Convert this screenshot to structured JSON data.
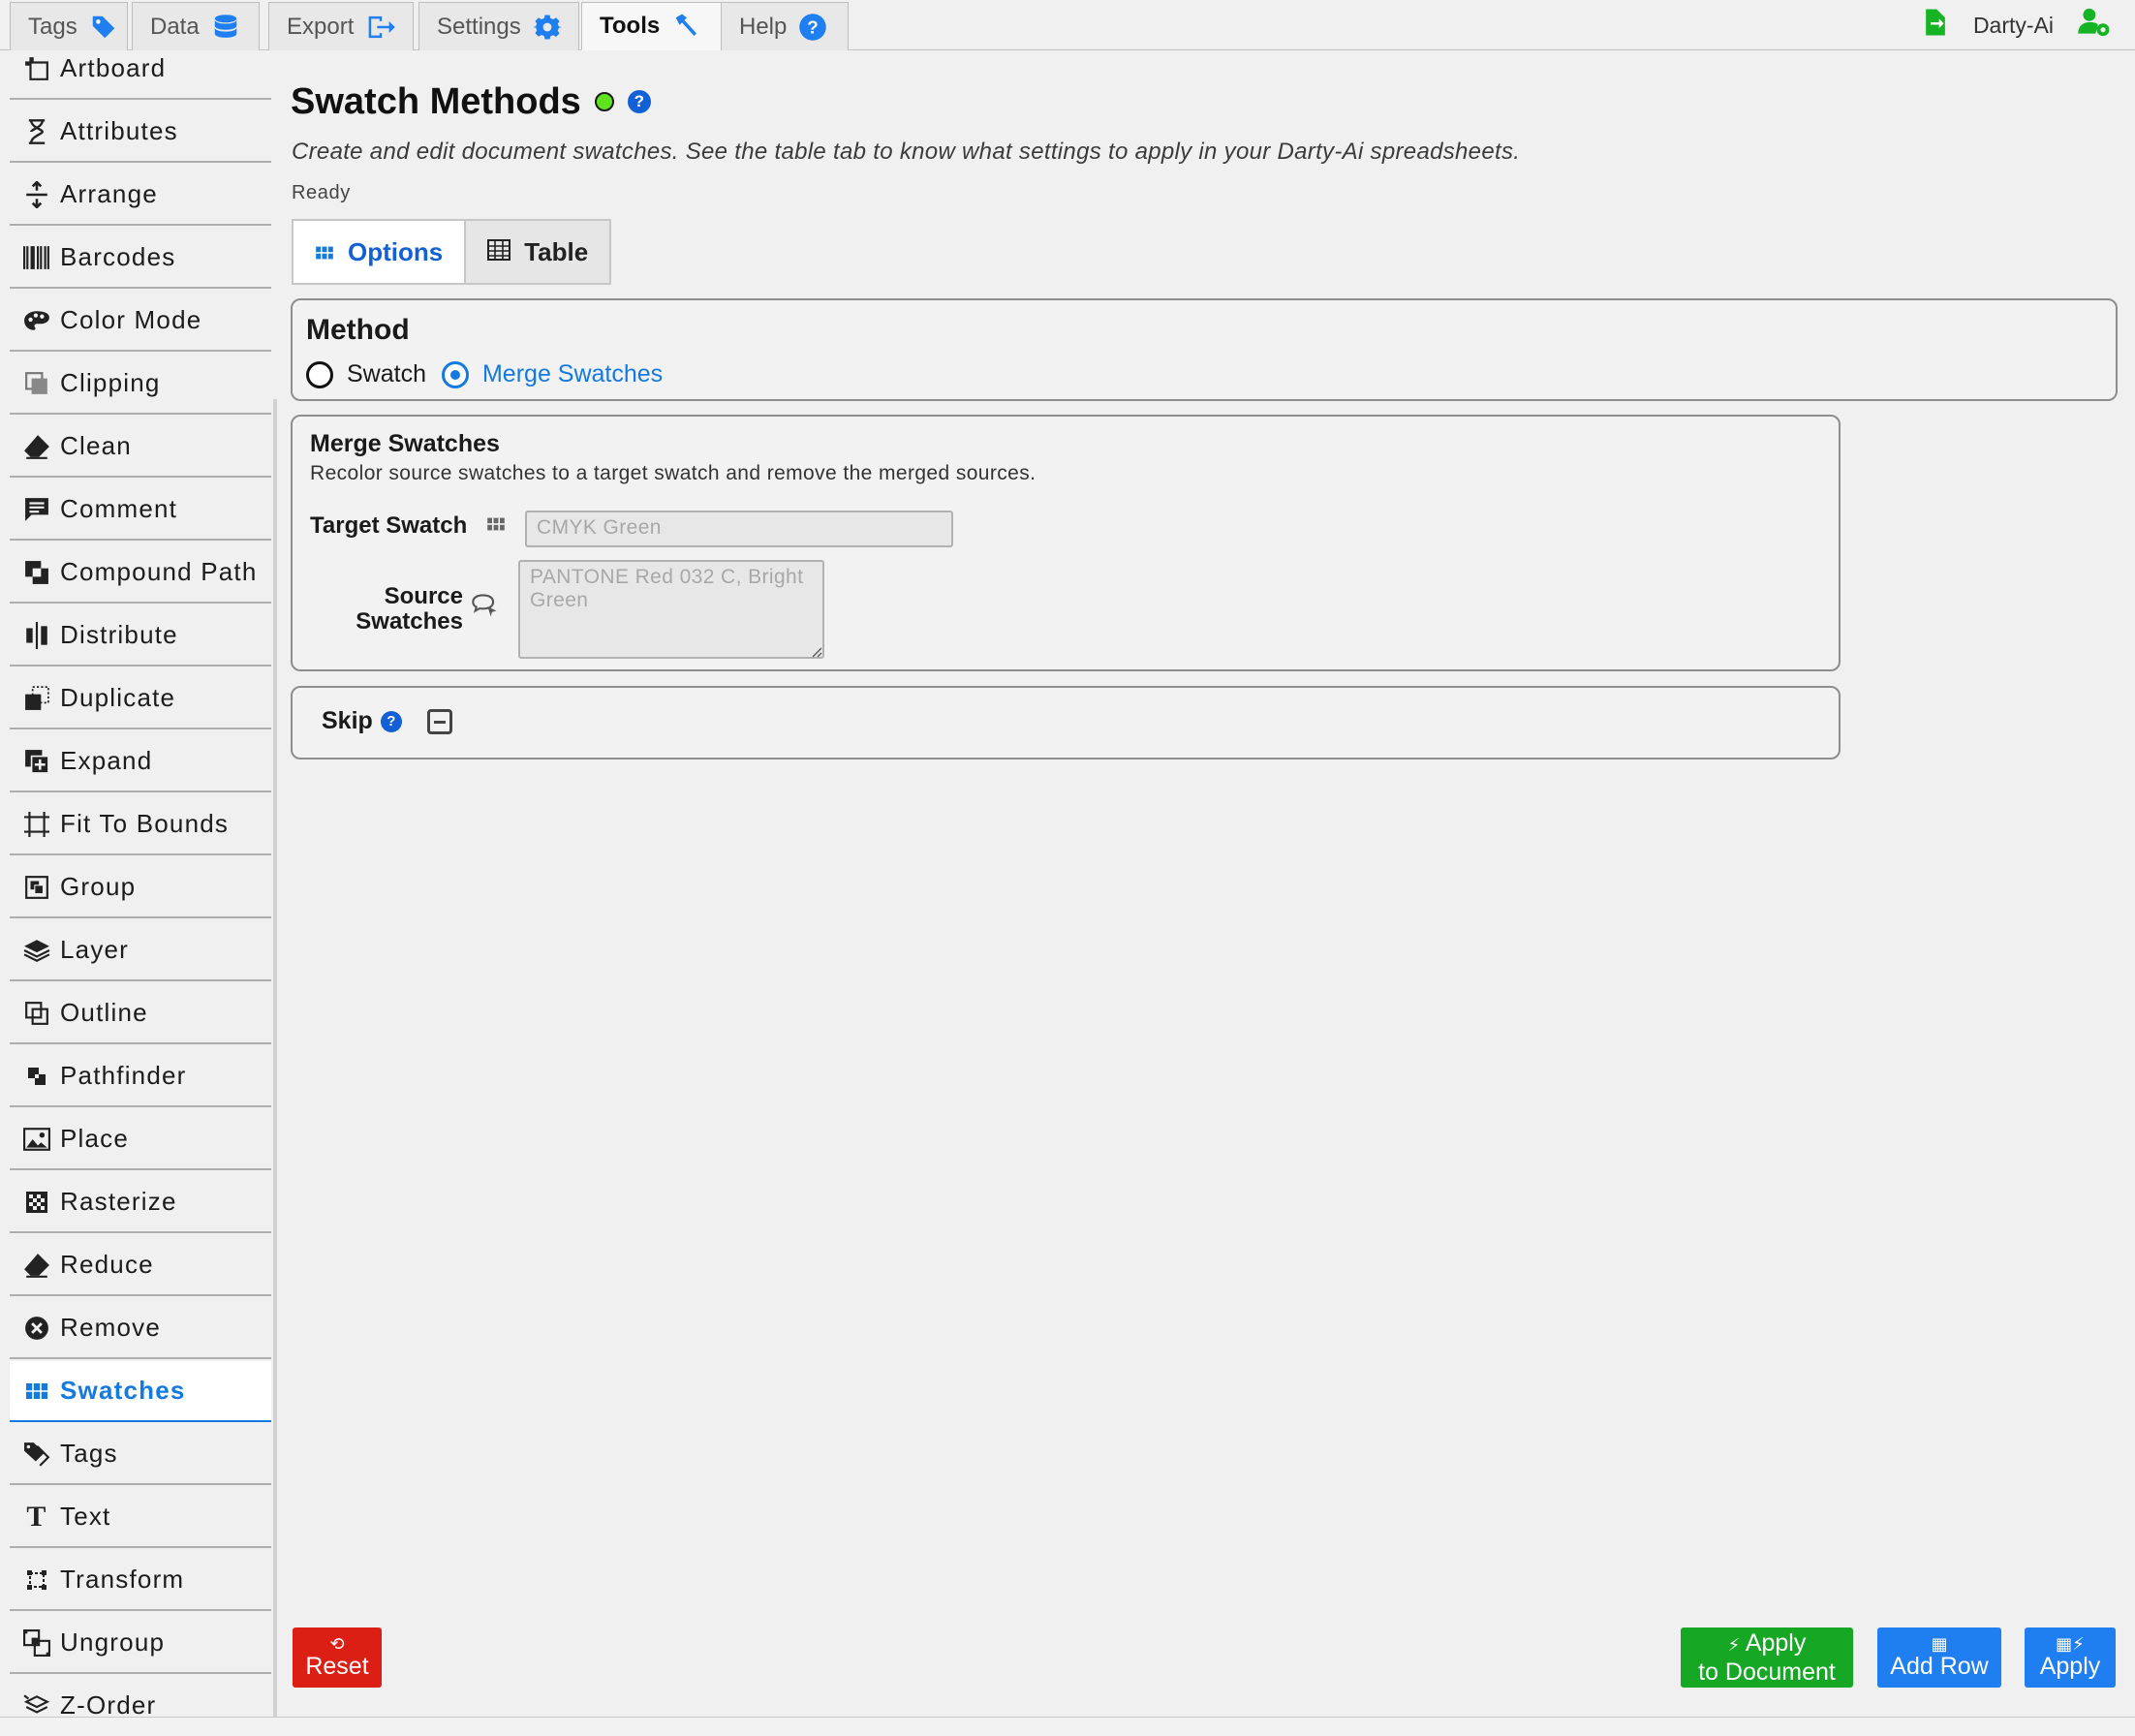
{
  "top_tabs": [
    {
      "label": "Tags",
      "icon": "tag-icon"
    },
    {
      "label": "Data",
      "icon": "database-icon"
    },
    {
      "label": "Export",
      "icon": "export-icon"
    },
    {
      "label": "Settings",
      "icon": "gear-icon"
    },
    {
      "label": "Tools",
      "icon": "hammer-icon"
    },
    {
      "label": "Help",
      "icon": "help-icon"
    }
  ],
  "active_top_tab": "Tools",
  "user": {
    "name": "Darty-Ai"
  },
  "sidebar": {
    "items": [
      {
        "label": "Artboard",
        "icon": "artboard-icon"
      },
      {
        "label": "Attributes",
        "icon": "attributes-icon"
      },
      {
        "label": "Arrange",
        "icon": "arrange-icon"
      },
      {
        "label": "Barcodes",
        "icon": "barcode-icon"
      },
      {
        "label": "Color Mode",
        "icon": "palette-icon"
      },
      {
        "label": "Clipping",
        "icon": "clipping-icon"
      },
      {
        "label": "Clean",
        "icon": "eraser-icon"
      },
      {
        "label": "Comment",
        "icon": "comment-icon"
      },
      {
        "label": "Compound Path",
        "icon": "compound-path-icon"
      },
      {
        "label": "Distribute",
        "icon": "distribute-icon"
      },
      {
        "label": "Duplicate",
        "icon": "duplicate-icon"
      },
      {
        "label": "Expand",
        "icon": "expand-icon"
      },
      {
        "label": "Fit To Bounds",
        "icon": "fit-bounds-icon"
      },
      {
        "label": "Group",
        "icon": "group-icon"
      },
      {
        "label": "Layer",
        "icon": "layer-icon"
      },
      {
        "label": "Outline",
        "icon": "outline-icon"
      },
      {
        "label": "Pathfinder",
        "icon": "pathfinder-icon"
      },
      {
        "label": "Place",
        "icon": "image-icon"
      },
      {
        "label": "Rasterize",
        "icon": "checker-icon"
      },
      {
        "label": "Reduce",
        "icon": "eraser-icon"
      },
      {
        "label": "Remove",
        "icon": "remove-icon"
      },
      {
        "label": "Swatches",
        "icon": "swatches-icon"
      },
      {
        "label": "Tags",
        "icon": "tags-icon"
      },
      {
        "label": "Text",
        "icon": "text-icon"
      },
      {
        "label": "Transform",
        "icon": "transform-icon"
      },
      {
        "label": "Ungroup",
        "icon": "ungroup-icon"
      },
      {
        "label": "Z-Order",
        "icon": "z-order-icon"
      }
    ],
    "active": "Swatches"
  },
  "main": {
    "title": "Swatch Methods",
    "description": "Create and edit document swatches. See the table tab to know what settings to apply in your Darty-Ai spreadsheets.",
    "status": "Ready",
    "status_color": "#5ee31f",
    "tabs": [
      {
        "label": "Options",
        "active": true
      },
      {
        "label": "Table",
        "active": false
      }
    ],
    "method": {
      "title": "Method",
      "options": [
        "Swatch",
        "Merge Swatches"
      ],
      "selected": "Merge Swatches"
    },
    "merge": {
      "title": "Merge Swatches",
      "subtitle": "Recolor source swatches to a target swatch and remove the merged sources.",
      "target_label": "Target Swatch",
      "target_placeholder": "CMYK Green",
      "source_label_1": "Source",
      "source_label_2": "Swatches",
      "source_placeholder": "PANTONE Red 032 C, Bright Green"
    },
    "skip": {
      "label": "Skip"
    }
  },
  "buttons": {
    "reset": "Reset",
    "apply_doc_1": "Apply",
    "apply_doc_2": "to Document",
    "add_row": "Add Row",
    "apply": "Apply"
  },
  "colors": {
    "accent": "#1479e0",
    "reset": "#db1f14",
    "apply_doc": "#16a824",
    "blue_button": "#1f7ff0"
  }
}
